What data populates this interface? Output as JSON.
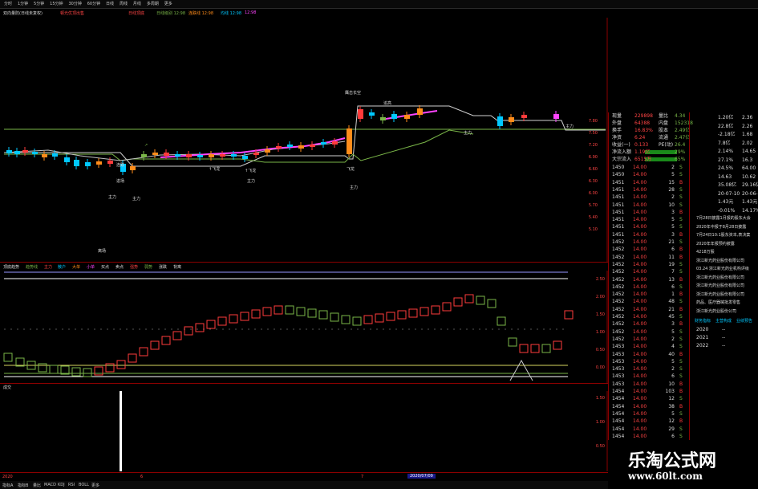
{
  "topbar": {
    "tabs": [
      "分时",
      "1分钟",
      "5分钟",
      "15分钟",
      "30分钟",
      "60分钟",
      "日线",
      "周线",
      "月线",
      "多周期",
      "更多"
    ]
  },
  "titlebar": {
    "name": "双向量防(日线未复权)",
    "indicator": "顿光优顶出售",
    "status": [
      "日线顶底",
      "日线级别 12:98",
      "连跌线 12:98",
      "均线 12:98",
      "12:98"
    ]
  },
  "main_chart": {
    "annotations": [
      "鹰击长空",
      "追高",
      "连跌",
      "↗",
      "↑飞龙",
      "↑飞龙",
      "主力",
      "主力",
      "主力",
      "主力",
      "进场",
      "飞龙",
      "主力",
      "主力",
      "离场"
    ],
    "price_labels": [
      "7.80",
      "7.50",
      "7.20",
      "6.90",
      "6.60",
      "6.30",
      "6.00",
      "5.70",
      "5.40",
      "5.10"
    ]
  },
  "sub_chart": {
    "header": "顶底趋势",
    "items": [
      "趋势线",
      "主力",
      "散户",
      "大单",
      "小单",
      "买点",
      "卖点",
      "强势",
      "弱势",
      "涨跌",
      "背离"
    ]
  },
  "vol_chart": {
    "header": "成交"
  },
  "bottombar": {
    "tabs": [
      "指标A",
      "指标B",
      "量比",
      "MACD",
      "KDJ",
      "RSI",
      "BOLL",
      "更多"
    ],
    "date": "2020/07/09"
  },
  "quote": {
    "rows": [
      {
        "k": "现量",
        "v": "229898",
        "k2": "量比",
        "v2": "4.34"
      },
      {
        "k": "外盘",
        "v": "64388",
        "k2": "内盘",
        "v2": "152318"
      },
      {
        "k": "换手",
        "v": "16.83%",
        "k2": "股本",
        "v2": "2.49亿"
      },
      {
        "k": "净资",
        "v": "6.24",
        "k2": "流通",
        "v2": "2.47亿"
      },
      {
        "k": "收益(一)",
        "v": "0.133",
        "k2": "PE(动)",
        "v2": "26.4"
      },
      {
        "k": "净流入额",
        "v": "1.19亿",
        "k2": "",
        "v2": "29%"
      },
      {
        "k": "大宗流入",
        "v": "6515万",
        "k2": "",
        "v2": "65%"
      }
    ],
    "ticks": [
      [
        "1450",
        "14.00",
        "2",
        "S"
      ],
      [
        "1450",
        "14.00",
        "5",
        "S"
      ],
      [
        "1451",
        "14.00",
        "15",
        "B"
      ],
      [
        "1451",
        "14.00",
        "28",
        "S"
      ],
      [
        "1451",
        "14.00",
        "2",
        "S"
      ],
      [
        "1451",
        "14.00",
        "10",
        "S"
      ],
      [
        "1451",
        "14.00",
        "3",
        "B"
      ],
      [
        "1451",
        "14.00",
        "5",
        "S"
      ],
      [
        "1451",
        "14.00",
        "5",
        "S"
      ],
      [
        "1451",
        "14.00",
        "3",
        "B"
      ],
      [
        "1452",
        "14.00",
        "21",
        "S"
      ],
      [
        "1452",
        "14.00",
        "6",
        "B"
      ],
      [
        "1452",
        "14.00",
        "11",
        "B"
      ],
      [
        "1452",
        "14.00",
        "19",
        "S"
      ],
      [
        "1452",
        "14.00",
        "7",
        "S"
      ],
      [
        "1452",
        "14.00",
        "13",
        "B"
      ],
      [
        "1452",
        "14.00",
        "6",
        "S"
      ],
      [
        "1452",
        "14.00",
        "1",
        "B"
      ],
      [
        "1452",
        "14.00",
        "48",
        "S"
      ],
      [
        "1452",
        "14.00",
        "21",
        "B"
      ],
      [
        "1452",
        "14.00",
        "45",
        "S"
      ],
      [
        "1452",
        "14.00",
        "3",
        "B"
      ],
      [
        "1452",
        "14.00",
        "5",
        "S"
      ],
      [
        "1452",
        "14.00",
        "2",
        "S"
      ],
      [
        "1453",
        "14.00",
        "4",
        "S"
      ],
      [
        "1453",
        "14.00",
        "40",
        "B"
      ],
      [
        "1453",
        "14.00",
        "5",
        "S"
      ],
      [
        "1453",
        "14.00",
        "2",
        "S"
      ],
      [
        "1453",
        "14.00",
        "6",
        "S"
      ],
      [
        "1453",
        "14.00",
        "10",
        "B"
      ],
      [
        "1454",
        "14.00",
        "103",
        "B"
      ],
      [
        "1454",
        "14.00",
        "12",
        "S"
      ],
      [
        "1454",
        "14.00",
        "38",
        "B"
      ],
      [
        "1454",
        "14.00",
        "5",
        "S"
      ],
      [
        "1454",
        "14.00",
        "12",
        "B"
      ],
      [
        "1454",
        "14.00",
        "29",
        "S"
      ],
      [
        "1454",
        "14.00",
        "6",
        "S"
      ],
      [
        "1454",
        "14.00",
        "183",
        "B"
      ],
      [
        "1455",
        "14.00",
        "14",
        "S"
      ],
      [
        "1455",
        "14.00",
        "8",
        "B"
      ],
      [
        "1455",
        "14.00",
        "4",
        "S"
      ],
      [
        "1455",
        "14.00",
        "2",
        "S"
      ],
      [
        "1455",
        "14.00",
        "1",
        "S"
      ]
    ],
    "f10": [
      [
        "1.20亿",
        "2.36"
      ],
      [
        "22.8亿",
        "2.26"
      ],
      [
        "-2.18亿",
        "1.68"
      ],
      [
        "7.8亿",
        "2.02"
      ],
      [
        "2.14%",
        "14.65"
      ],
      [
        "27.1%",
        "16.3"
      ],
      [
        "24.5%",
        "64.00"
      ],
      [
        "14.63",
        "10.62"
      ],
      [
        "35.08亿",
        "29.16亿"
      ],
      [
        "20-07-10",
        "20-06-30"
      ],
      [
        "1.43元",
        "1.43元"
      ],
      [
        "-0.01%",
        "14.17%"
      ]
    ],
    "news": [
      "7月28日披露1月报的股东大会",
      "2020年中报于8月28日披露",
      "7月24日10:1股东资本,表决案",
      "2020年年报预约披露",
      "4218万股",
      "浙江新光药业股份有限公司",
      "03.24 浙江新光药业机构评级",
      "浙江新光药业股份有限公司",
      "浙江新光药业股份有限公司",
      "浙江新光药业股份有限公司",
      "药品、医疗器械批发零售",
      "浙江新光药业股份公司"
    ],
    "years": [
      "2020",
      "2021",
      "2022"
    ],
    "tabs": [
      "财务指标",
      "主营构成",
      "业绩预告"
    ]
  },
  "watermark": {
    "title": "乐淘公式网",
    "url": "www.60lt.com"
  },
  "colors": {
    "up": "#ff3b3b",
    "down": "#00c8ff",
    "ma": "#ffffff",
    "green": "#7ab648",
    "magenta": "#ff44ff",
    "orange": "#ff8c1a",
    "bg": "#000000"
  }
}
